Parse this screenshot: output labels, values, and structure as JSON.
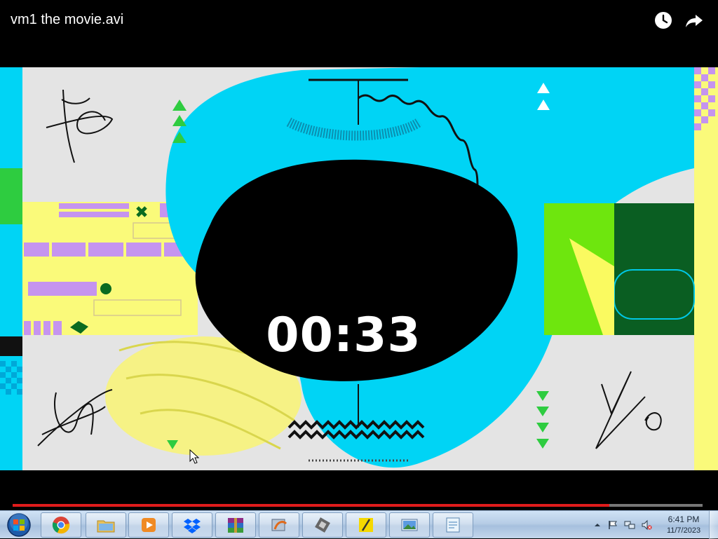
{
  "player": {
    "title": "vm1 the movie.avi",
    "watch_later_icon": "clock-icon",
    "share_icon": "share-arrow-icon",
    "timer": "00:33",
    "progress_fraction": 0.865
  },
  "taskbar": {
    "start_icon": "windows-start-orb-icon",
    "apps": [
      {
        "name": "chrome",
        "icon": "chrome-icon"
      },
      {
        "name": "file-explorer",
        "icon": "folder-icon"
      },
      {
        "name": "media-player",
        "icon": "play-icon"
      },
      {
        "name": "dropbox",
        "icon": "dropbox-icon"
      },
      {
        "name": "winrar",
        "icon": "winrar-icon"
      },
      {
        "name": "setup",
        "icon": "installer-icon"
      },
      {
        "name": "tool",
        "icon": "tool-icon"
      },
      {
        "name": "app-yellow",
        "icon": "yellow-app-icon"
      },
      {
        "name": "image-viewer",
        "icon": "photo-icon"
      },
      {
        "name": "notepad",
        "icon": "notepad-icon"
      }
    ],
    "tray": {
      "time": "6:41 PM",
      "date": "11/7/2023"
    }
  },
  "colors": {
    "cyan": "#00d4f5",
    "yellow": "#fafa7a",
    "lavender": "#c594ef",
    "green": "#2ecc40",
    "progress": "#e01b1b"
  }
}
